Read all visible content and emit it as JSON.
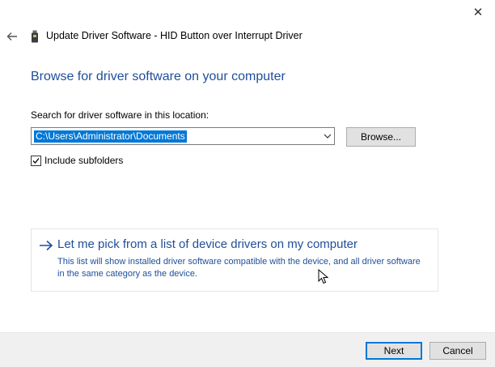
{
  "window": {
    "title": "Update Driver Software - HID Button over Interrupt Driver",
    "close_glyph": "✕"
  },
  "icons": {
    "back": "back-arrow-icon",
    "device": "usb-device-icon",
    "close": "close-icon",
    "combo": "chevron-down-icon",
    "checkbox": "checkmark-icon",
    "pick": "right-arrow-icon"
  },
  "colors": {
    "accent": "#1f4e99",
    "selection": "#0078d7",
    "footer": "#f0f0f0"
  },
  "main": {
    "heading": "Browse for driver software on your computer",
    "search_label": "Search for driver software in this location:",
    "path_value": "C:\\Users\\Administrator\\Documents",
    "browse_label": "Browse...",
    "include_subfolders": {
      "label": "Include subfolders",
      "checked": true
    },
    "pick_option": {
      "title": "Let me pick from a list of device drivers on my computer",
      "description": "This list will show installed driver software compatible with the device, and all driver software in the same category as the device."
    }
  },
  "footer": {
    "next_label": "Next",
    "cancel_label": "Cancel"
  }
}
